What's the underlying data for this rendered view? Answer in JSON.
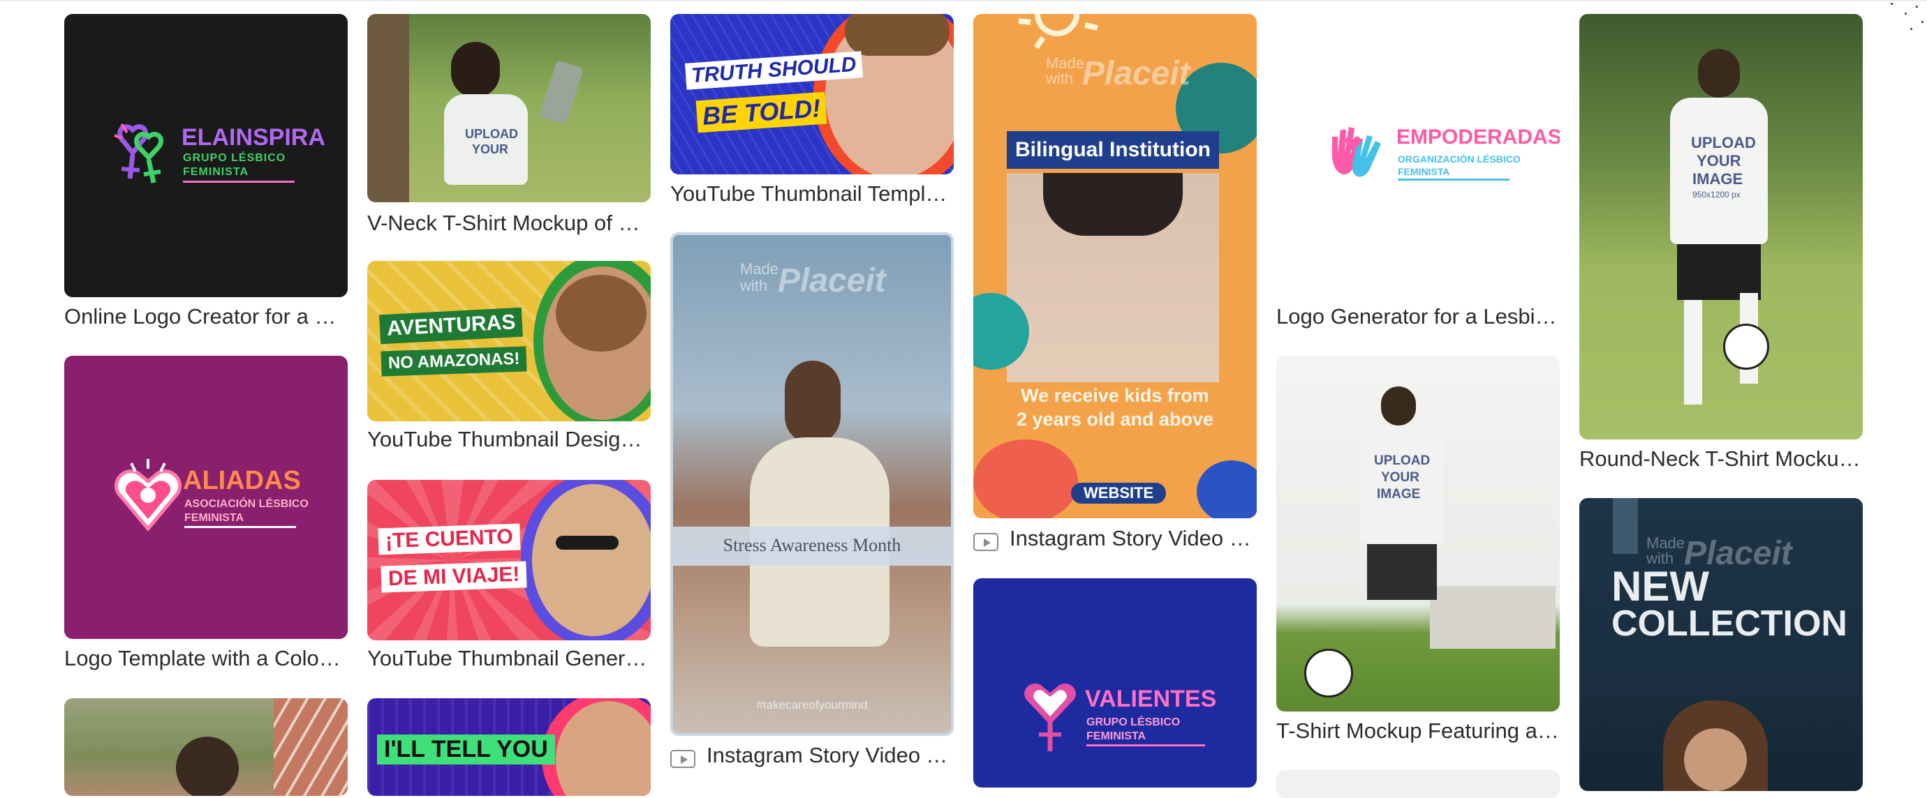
{
  "cards": [
    {
      "caption": "Online Logo Creator for a Pro-Feminist Group"
    },
    {
      "caption": "Logo Template with a Colorful Heart"
    },
    {
      "caption": "V-Neck T-Shirt Mockup of a Girl"
    },
    {
      "caption": "YouTube Thumbnail Design for a Travel Vlog"
    },
    {
      "caption": "YouTube Thumbnail Generator"
    },
    {
      "caption": "YouTube Thumbnail Template"
    },
    {
      "caption": "Instagram Story Video Template"
    },
    {
      "caption": "Instagram Story Video Maker"
    },
    {
      "caption": "Logo Generator for a Lesbian Feminist Organization"
    },
    {
      "caption": "T-Shirt Mockup Featuring a Man Playing Soccer"
    },
    {
      "caption": "Round-Neck T-Shirt Mockup of a Man"
    }
  ],
  "art": {
    "elainspira": {
      "name": "ELAINSPIRA",
      "line1": "GRUPO LÉSBICO",
      "line2": "FEMINISTA"
    },
    "aliadas": {
      "name": "ALIADAS",
      "line1": "ASOCIACIÓN LÉSBICO",
      "line2": "FEMINISTA"
    },
    "empoderadas": {
      "name": "EMPODERADAS",
      "line1": "ORGANIZACIÓN LÉSBICO",
      "line2": "FEMINISTA"
    },
    "valientes": {
      "name": "VALIENTES",
      "line1": "GRUPO LÉSBICO",
      "line2": "FEMINISTA"
    },
    "tee": {
      "line1": "UPLOAD",
      "line2": "YOUR",
      "line3": "IMAGE",
      "size": "950x1200 px"
    },
    "aventuras": {
      "line1": "AVENTURAS",
      "line2": "NO AMAZONAS!"
    },
    "cuento": {
      "line1": "¡TE CUENTO",
      "line2": "DE MI VIAJE!"
    },
    "truth": {
      "line1": "TRUTH SHOULD",
      "line2": "BE TOLD!"
    },
    "tell": {
      "line1": "I'LL TELL YOU"
    },
    "stress": {
      "title": "Stress Awareness Month",
      "tag": "#takecareofyourmind"
    },
    "bilingual": {
      "title": "Bilingual Institution",
      "line1": "We receive kids from",
      "line2": "2 years old and above",
      "button": "WEBSITE"
    },
    "collection": {
      "line1": "NEW",
      "line2": "COLLECTION"
    },
    "watermark": {
      "made": "Made",
      "with": "with",
      "brand": "Placeit"
    }
  }
}
